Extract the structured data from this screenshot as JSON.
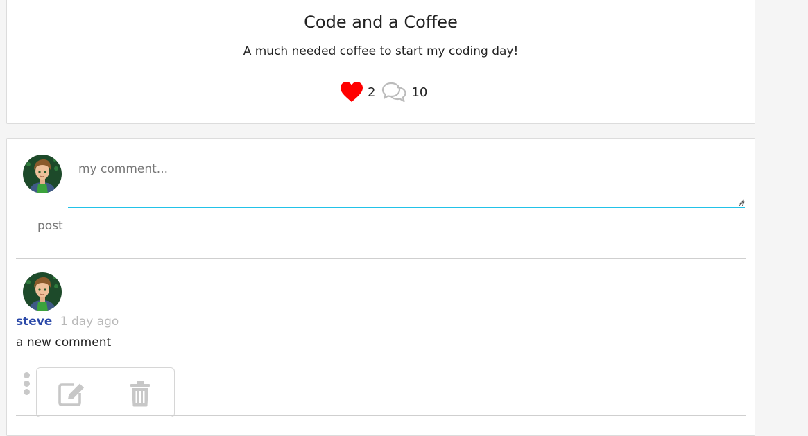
{
  "post": {
    "title": "Code and a Coffee",
    "description": "A much needed coffee to start my coding day!",
    "likes": "2",
    "comments": "10",
    "like_icon": "heart-icon",
    "comment_icon": "speech-bubbles-icon",
    "like_color": "#ff0000"
  },
  "composer": {
    "placeholder": "my comment...",
    "value": "",
    "post_label": "post",
    "accent_color": "#22c2e8"
  },
  "comments": [
    {
      "author": "steve",
      "time": "1 day ago",
      "text": "a new comment",
      "author_color": "#2a48a8"
    }
  ],
  "comment_actions": {
    "more_icon": "vertical-dots-icon",
    "edit_icon": "edit-icon",
    "delete_icon": "trash-icon"
  }
}
